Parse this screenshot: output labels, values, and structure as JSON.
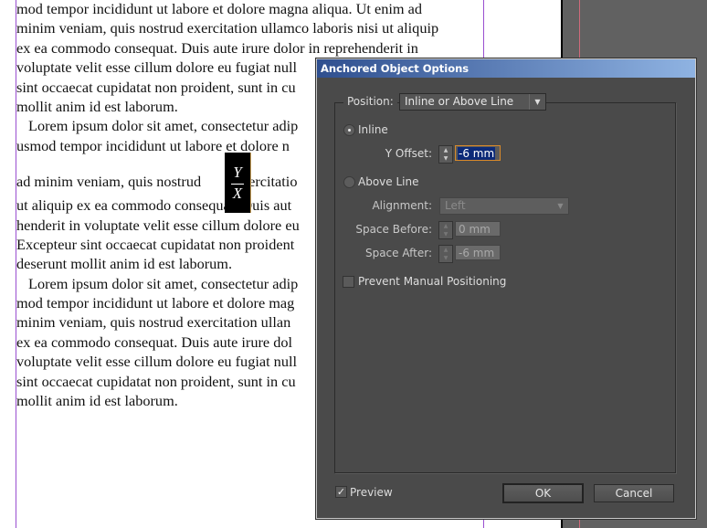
{
  "document": {
    "lines": [
      "mod tempor incididunt ut labore et dolore magna aliqua. Ut enim ad",
      "minim veniam, quis nostrud exercitation ullamco laboris nisi ut aliquip",
      "ex ea commodo consequat. Duis aute irure dolor in reprehenderit in",
      "voluptate velit esse cillum dolore eu fugiat null",
      "sint occaecat cupidatat non proident, sunt in cu",
      "mollit anim id est laborum.",
      "Lorem ipsum dolor sit amet, consectetur adip",
      "usmod tempor incididunt ut labore et dolore n",
      "ad minim veniam, quis nostrud         exercitatio",
      "ut aliquip ex ea commodo consequat. Duis aut",
      "henderit in voluptate velit esse cillum dolore eu",
      "Excepteur sint occaecat cupidatat non proident",
      "deserunt mollit anim id est laborum.",
      "Lorem ipsum dolor sit amet, consectetur adip",
      "mod tempor incididunt ut labore et dolore mag",
      "minim veniam, quis nostrud exercitation ullan",
      "ex ea commodo consequat. Duis aute irure dol",
      "voluptate velit esse cillum dolore eu fugiat null",
      "sint occaecat cupidatat non proident, sunt in cu",
      "mollit anim id est laborum."
    ],
    "anchored_object": {
      "numerator": "Y",
      "denominator": "X"
    }
  },
  "dialog": {
    "title": "Anchored Object Options",
    "position_label": "Position:",
    "position_value": "Inline or Above Line",
    "inline_label": "Inline",
    "y_offset_label": "Y Offset:",
    "y_offset_value": "-6 mm",
    "above_line_label": "Above Line",
    "alignment_label": "Alignment:",
    "alignment_value": "Left",
    "space_before_label": "Space Before:",
    "space_before_value": "0 mm",
    "space_after_label": "Space After:",
    "space_after_value": "-6 mm",
    "prevent_label": "Prevent Manual Positioning",
    "preview_label": "Preview",
    "ok_label": "OK",
    "cancel_label": "Cancel"
  }
}
